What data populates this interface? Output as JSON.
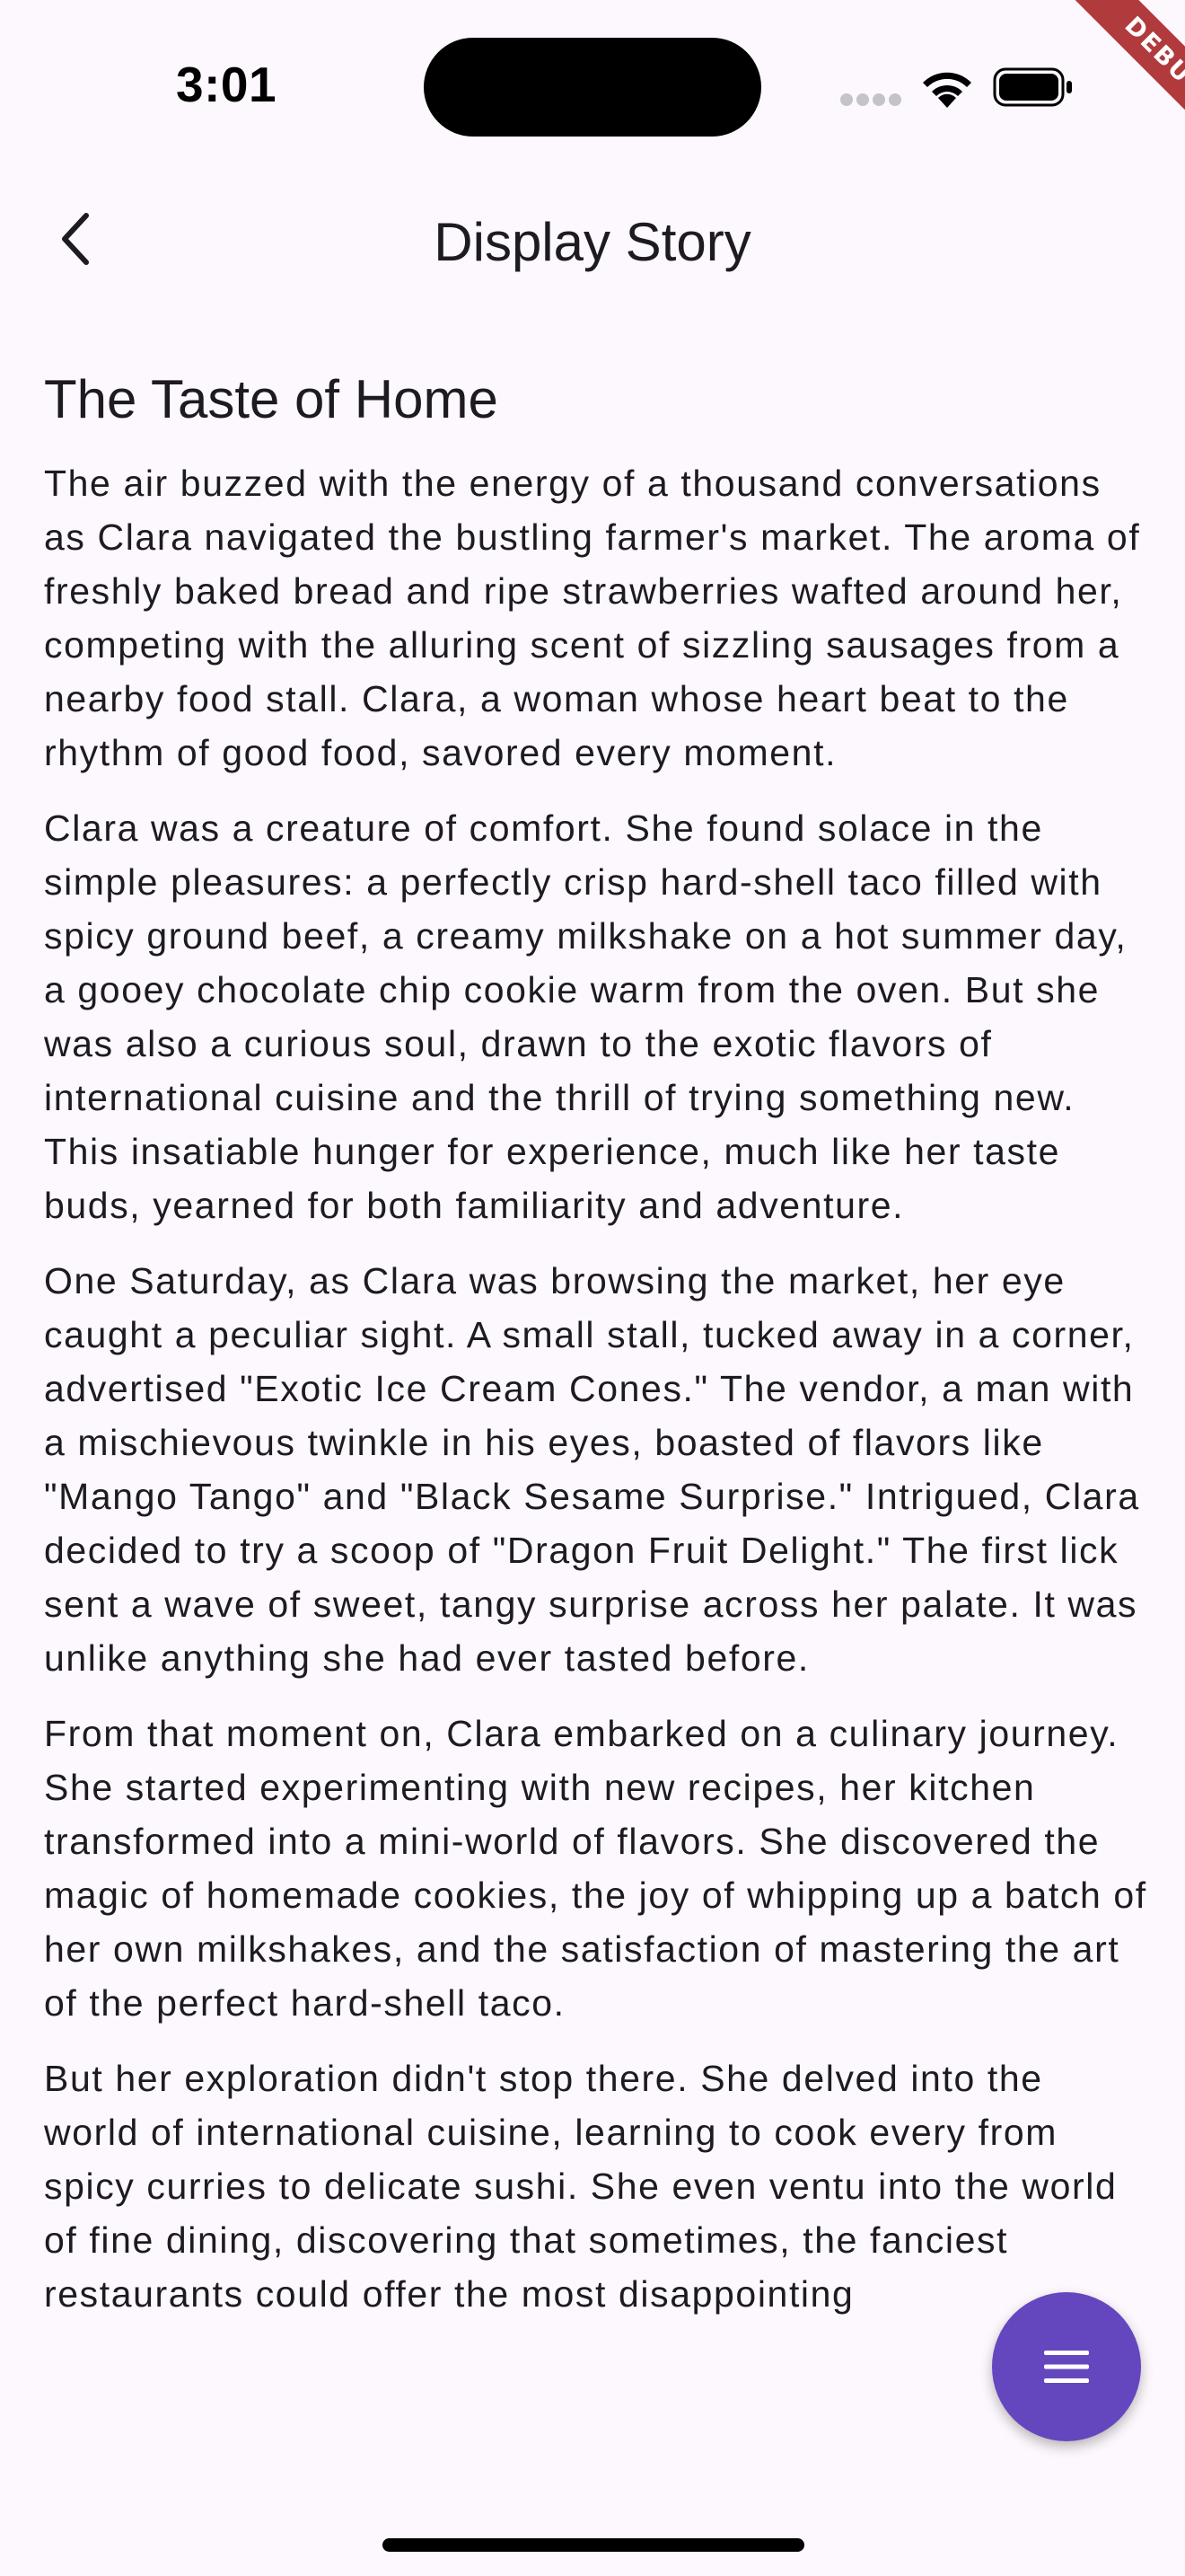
{
  "status_bar": {
    "time": "3:01",
    "icons": [
      "signal-dots-icon",
      "wifi-icon",
      "battery-icon"
    ]
  },
  "debug_banner": "DEBUG",
  "app_bar": {
    "back_icon": "chevron-left-icon",
    "title": "Display Story"
  },
  "story": {
    "title": "The Taste of Home",
    "paragraphs": [
      "The air buzzed with the energy of a thousand conversations as Clara navigated the bustling farmer's market. The aroma of freshly baked bread and ripe strawberries wafted around her, competing with the alluring scent of sizzling sausages from a nearby food stall. Clara, a woman whose heart beat to the rhythm of good food, savored every moment.",
      "Clara was a creature of comfort. She found solace in the simple pleasures: a perfectly crisp hard-shell taco filled with spicy ground beef, a creamy milkshake on a hot summer day, a gooey chocolate chip cookie warm from the oven. But she was also a curious soul, drawn to the exotic flavors of international cuisine and the thrill of trying something new. This insatiable hunger for experience, much like her taste buds, yearned for both familiarity and adventure.",
      "One Saturday, as Clara was browsing the market, her eye caught a peculiar sight. A small stall, tucked away in a corner, advertised \"Exotic Ice Cream Cones.\" The vendor, a man with a mischievous twinkle in his eyes, boasted of flavors like \"Mango Tango\" and \"Black Sesame Surprise.\" Intrigued, Clara decided to try a scoop of \"Dragon Fruit Delight.\" The first lick sent a wave of sweet, tangy surprise across her palate. It was unlike anything she had ever tasted before.",
      "From that moment on, Clara embarked on a culinary journey. She started experimenting with new recipes, her kitchen transformed into a mini-world of flavors. She discovered the magic of homemade cookies, the joy of whipping up a batch of her own milkshakes, and the satisfaction of mastering the art of the perfect hard-shell taco.",
      "But her exploration didn't stop there. She delved into the world of international cuisine, learning to cook every from spicy curries to delicate sushi. She even ventu into the world of fine dining, discovering that sometimes, the fanciest restaurants could offer the most disappointing"
    ]
  },
  "fab": {
    "icon": "menu-icon",
    "color": "#6447bf"
  },
  "colors": {
    "background": "#fdf8fd",
    "text": "#1d1b20",
    "debug_ribbon": "#b13a3d"
  }
}
